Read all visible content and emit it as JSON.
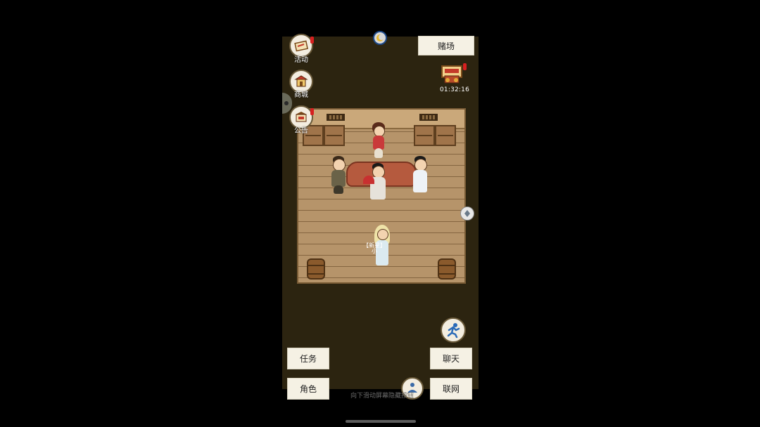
{
  "top": {
    "casino_label": "赌场",
    "event_timer": "01:32:16"
  },
  "left_menu": [
    {
      "label": "活动",
      "icon": "activity-scroll-icon"
    },
    {
      "label": "商城",
      "icon": "shop-stall-icon"
    },
    {
      "label": "公告",
      "icon": "notice-board-icon"
    }
  ],
  "scene": {
    "player_name": "【新星】",
    "player_sub": "小"
  },
  "bottom_buttons": {
    "task": "任务",
    "role": "角色",
    "chat": "聊天",
    "network": "联网"
  },
  "hint": "向下滑动屏幕隐藏按钮",
  "colors": {
    "screen_bg": "#2c2410",
    "floor": "#b6946a",
    "button_paper": "#f5f1e4",
    "alert_red": "#d62020"
  }
}
